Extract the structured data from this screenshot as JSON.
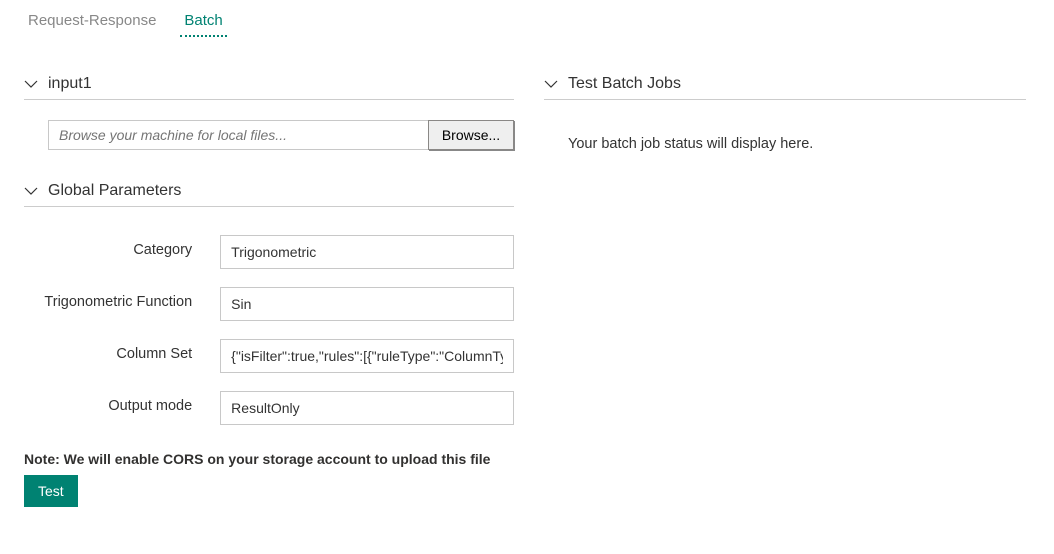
{
  "tabs": {
    "request_response": "Request-Response",
    "batch": "Batch"
  },
  "sections": {
    "input1": "input1",
    "global_params": "Global Parameters",
    "test_batch": "Test Batch Jobs"
  },
  "file": {
    "placeholder": "Browse your machine for local files...",
    "browse_label": "Browse..."
  },
  "params": {
    "category": {
      "label": "Category",
      "value": "Trigonometric"
    },
    "trig_fn": {
      "label": "Trigonometric Function",
      "value": "Sin"
    },
    "column_set": {
      "label": "Column Set",
      "value": "{\"isFilter\":true,\"rules\":[{\"ruleType\":\"ColumnType\""
    },
    "output_mode": {
      "label": "Output mode",
      "value": "ResultOnly"
    }
  },
  "note": "Note: We will enable CORS on your storage account to upload this file",
  "test_button": "Test",
  "status_placeholder": "Your batch job status will display here."
}
